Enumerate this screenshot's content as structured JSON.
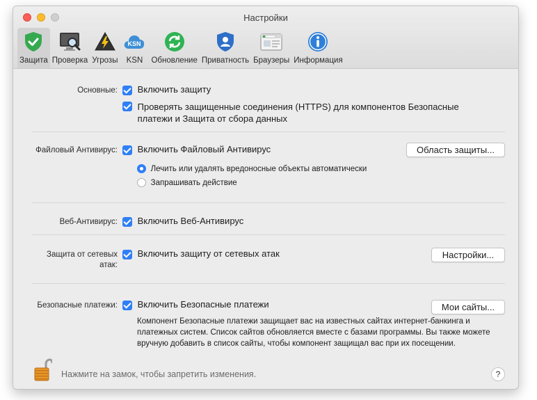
{
  "window": {
    "title": "Настройки"
  },
  "toolbar": {
    "items": [
      {
        "label": "Защита",
        "icon": "shield-check-icon",
        "selected": true
      },
      {
        "label": "Проверка",
        "icon": "scan-monitor-icon"
      },
      {
        "label": "Угрозы",
        "icon": "threat-warning-icon"
      },
      {
        "label": "KSN",
        "icon": "ksn-cloud-icon"
      },
      {
        "label": "Обновление",
        "icon": "update-arrows-icon"
      },
      {
        "label": "Приватность",
        "icon": "privacy-user-icon"
      },
      {
        "label": "Браузеры",
        "icon": "browser-window-icon"
      },
      {
        "label": "Информация",
        "icon": "info-icon"
      }
    ]
  },
  "sections": {
    "basic": {
      "label": "Основные:",
      "enable_protection": "Включить защиту",
      "check_https_line1": "Проверять защищенные соединения (HTTPS) для компонентов Безопасные",
      "check_https_line2": "платежи и Защита от сбора данных"
    },
    "file_av": {
      "label": "Файловый Антивирус:",
      "enable": "Включить Файловый Антивирус",
      "button": "Область защиты...",
      "option_auto": "Лечить или удалять вредоносные объекты автоматически",
      "option_ask": "Запрашивать действие"
    },
    "web_av": {
      "label": "Веб-Антивирус:",
      "enable": "Включить Веб-Антивирус"
    },
    "network": {
      "label_line1": "Защита от сетевых",
      "label_line2": "атак:",
      "enable": "Включить защиту от сетевых атак",
      "button": "Настройки..."
    },
    "safe_money": {
      "label": "Безопасные платежи:",
      "enable": "Включить Безопасные платежи",
      "button": "Мои сайты...",
      "desc_line1": "Компонент Безопасные платежи защищает вас на известных сайтах интернет-банкинга и",
      "desc_line2": "платежных систем. Список сайтов обновляется вместе с базами программы. Вы также можете",
      "desc_line3": "вручную добавить в список сайты, чтобы компонент защищал вас при их посещении."
    }
  },
  "footer": {
    "lock_text": "Нажмите на замок, чтобы запретить изменения.",
    "help": "?"
  },
  "colors": {
    "accent": "#2f7ff7",
    "shield": "#35a94f",
    "update": "#2fb354",
    "ksn": "#3e8fd6",
    "info": "#2e7fd8"
  }
}
